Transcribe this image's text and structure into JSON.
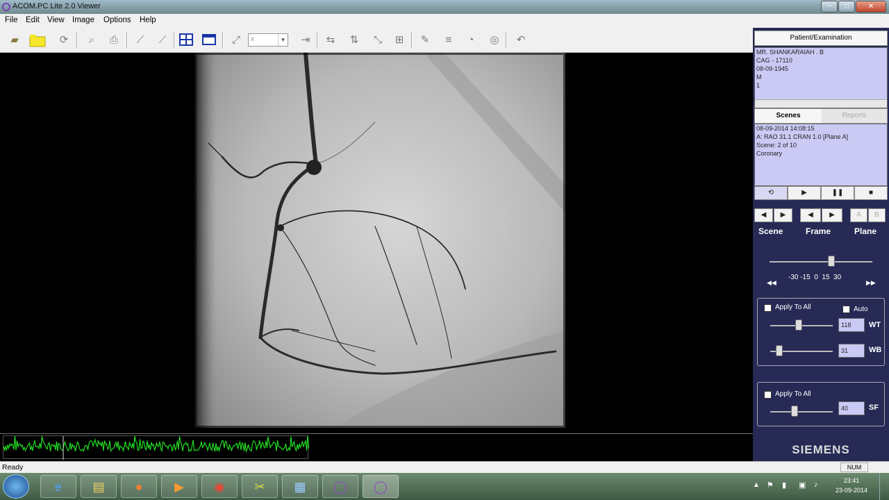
{
  "window": {
    "title": "ACOM.PC Lite 2.0 Viewer",
    "controls": [
      "−",
      "□",
      "✕"
    ]
  },
  "menu": [
    "File",
    "Edit",
    "View",
    "Image",
    "Options",
    "Help"
  ],
  "toolbar": {
    "zoom_value": "x"
  },
  "status": {
    "left": "Ready",
    "num": "NUM"
  },
  "panel": {
    "header": "Patient/Examination",
    "patient_lines": [
      "MR. SHANKARAIAH . B",
      "CAG - 17110",
      "08-09-1945",
      "M",
      "1"
    ],
    "tabs": [
      "Scenes",
      "Reports"
    ],
    "scene_lines": [
      "08-09-2014 14:08:15",
      "A: RAO 31.1 CRAN 1.0  [Plane A]",
      "Scene: 2 of 10",
      "Coronary"
    ],
    "nav_labels": [
      "Scene",
      "Frame",
      "Plane"
    ],
    "plane_buttons": [
      "A",
      "B"
    ],
    "speed_ticks": "-30 -15  0  15  30",
    "window": {
      "apply_to_all": "Apply To All",
      "auto": "Auto",
      "wt_value": "118",
      "wt_label": "WT",
      "wb_value": "31",
      "wb_label": "WB"
    },
    "sharpen": {
      "apply_to_all": "Apply To All",
      "sf_value": "40",
      "sf_label": "SF"
    },
    "brand": "SIEMENS"
  },
  "clock": {
    "time": "23:41",
    "date": "23-09-2014"
  },
  "colors": {
    "panel_bg": "#272a55",
    "info_bg": "#cbcaf5",
    "ecg_green": "#22dd22"
  }
}
